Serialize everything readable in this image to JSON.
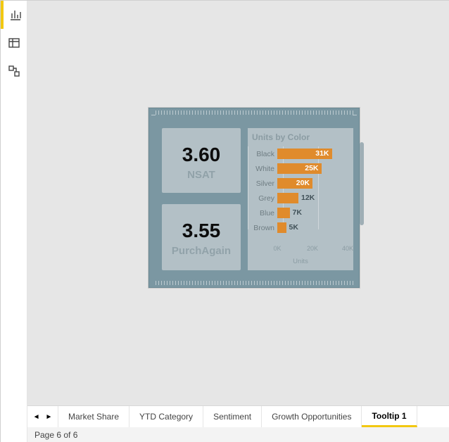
{
  "sidebar": {
    "items": [
      "report",
      "data",
      "model"
    ]
  },
  "cards": {
    "nsat": {
      "value": "3.60",
      "label": "NSAT"
    },
    "purchAgain": {
      "value": "3.55",
      "label": "PurchAgain"
    }
  },
  "chart_data": {
    "type": "bar",
    "orientation": "horizontal",
    "title": "Units by Color",
    "xlabel": "Units",
    "xlim": [
      0,
      40000
    ],
    "xticks": [
      0,
      20000,
      40000
    ],
    "xtick_labels": [
      "0K",
      "20K",
      "40K"
    ],
    "categories": [
      "Black",
      "White",
      "Silver",
      "Grey",
      "Blue",
      "Brown"
    ],
    "values": [
      31000,
      25000,
      20000,
      12000,
      7000,
      5000
    ],
    "value_labels": [
      "31K",
      "25K",
      "20K",
      "12K",
      "7K",
      "5K"
    ],
    "color": "#e08b2c"
  },
  "tabbar": {
    "tabs": [
      {
        "label": "Market Share",
        "active": false
      },
      {
        "label": "YTD Category",
        "active": false
      },
      {
        "label": "Sentiment",
        "active": false
      },
      {
        "label": "Growth Opportunities",
        "active": false
      },
      {
        "label": "Tooltip 1",
        "active": true
      }
    ]
  },
  "status": {
    "page_info": "Page 6 of 6"
  }
}
